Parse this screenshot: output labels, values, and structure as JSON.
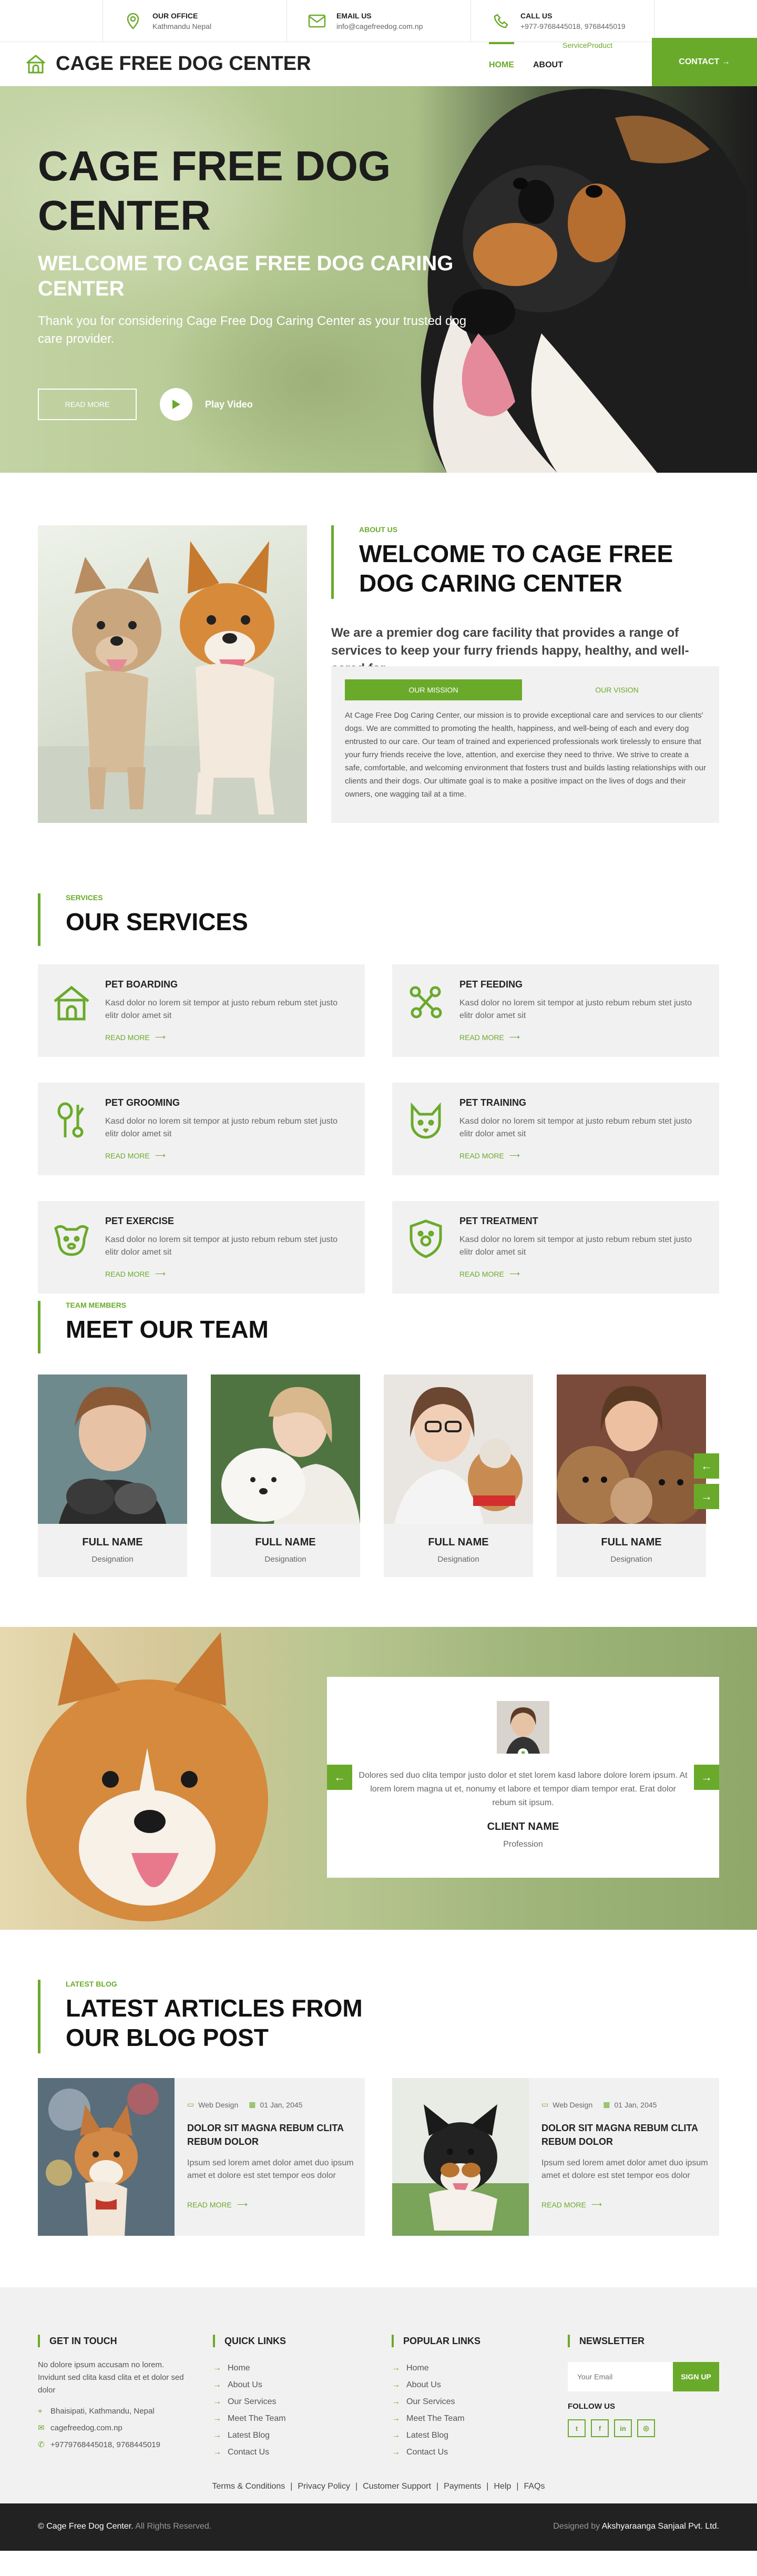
{
  "topbar": {
    "office": {
      "heading": "OUR OFFICE",
      "value": "Kathmandu Nepal",
      "icon": "location-pin-icon"
    },
    "email": {
      "heading": "EMAIL US",
      "value": "info@cagefreedog.com.np",
      "icon": "envelope-icon"
    },
    "call": {
      "heading": "CALL US",
      "value": "+977-9768445018, 9768445019",
      "icon": "phone-icon"
    }
  },
  "nav": {
    "brand": "CAGE FREE DOG CENTER",
    "items": [
      "HOME",
      "ABOUT"
    ],
    "dropdown": "ServiceProduct",
    "contact": "CONTACT →"
  },
  "hero": {
    "title": "CAGE FREE DOG CENTER",
    "subtitle": "WELCOME TO CAGE FREE DOG CARING CENTER",
    "text": "Thank you for considering Cage Free Dog Caring Center as your trusted dog care provider.",
    "read_more": "READ MORE",
    "play": "Play Video"
  },
  "about": {
    "tag": "ABOUT US",
    "heading": "WELCOME TO CAGE FREE DOG CARING CENTER",
    "lead": "We are a premier dog care facility that provides a range of services to keep your furry friends happy, healthy, and well-cared for.",
    "tab_mission": "OUR MISSION",
    "tab_vision": "OUR VISION",
    "text": "At Cage Free Dog Caring Center, our mission is to provide exceptional care and services to our clients' dogs. We are committed to promoting the health, happiness, and well-being of each and every dog entrusted to our care. Our team of trained and experienced professionals work tirelessly to ensure that your furry friends receive the love, attention, and exercise they need to thrive. We strive to create a safe, comfortable, and welcoming environment that fosters trust and builds lasting relationships with our clients and their dogs. Our ultimate goal is to make a positive impact on the lives of dogs and their owners, one wagging tail at a time."
  },
  "services": {
    "tag": "SERVICES",
    "heading": "OUR SERVICES",
    "read_more": "READ MORE",
    "items": [
      {
        "title": "PET BOARDING",
        "desc": "Kasd dolor no lorem sit tempor at justo rebum rebum stet justo elitr dolor amet sit",
        "icon": "dog-house-icon"
      },
      {
        "title": "PET FEEDING",
        "desc": "Kasd dolor no lorem sit tempor at justo rebum rebum stet justo elitr dolor amet sit",
        "icon": "bone-food-icon"
      },
      {
        "title": "PET GROOMING",
        "desc": "Kasd dolor no lorem sit tempor at justo rebum rebum stet justo elitr dolor amet sit",
        "icon": "scissors-comb-icon"
      },
      {
        "title": "PET TRAINING",
        "desc": "Kasd dolor no lorem sit tempor at justo rebum rebum stet justo elitr dolor amet sit",
        "icon": "cat-face-icon"
      },
      {
        "title": "PET EXERCISE",
        "desc": "Kasd dolor no lorem sit tempor at justo rebum rebum stet justo elitr dolor amet sit",
        "icon": "dog-face-icon"
      },
      {
        "title": "PET TREATMENT",
        "desc": "Kasd dolor no lorem sit tempor at justo rebum rebum stet justo elitr dolor amet sit",
        "icon": "shield-paw-icon"
      }
    ]
  },
  "team": {
    "tag": "TEAM MEMBERS",
    "heading": "MEET OUR TEAM",
    "members": [
      {
        "name": "FULL NAME",
        "role": "Designation"
      },
      {
        "name": "FULL NAME",
        "role": "Designation"
      },
      {
        "name": "FULL NAME",
        "role": "Designation"
      },
      {
        "name": "FULL NAME",
        "role": "Designation"
      }
    ]
  },
  "testimonial": {
    "quote": "Dolores sed duo clita tempor justo dolor et stet lorem kasd labore dolore lorem ipsum. At lorem lorem magna ut et, nonumy et labore et tempor diam tempor erat. Erat dolor rebum sit ipsum.",
    "name": "CLIENT NAME",
    "role": "Profession"
  },
  "blog": {
    "tag": "LATEST BLOG",
    "heading": "LATEST ARTICLES FROM OUR BLOG POST",
    "posts": [
      {
        "category": "Web Design",
        "date": "01 Jan, 2045",
        "title": "DOLOR SIT MAGNA REBUM CLITA REBUM DOLOR",
        "desc": "Ipsum sed lorem amet dolor amet duo ipsum amet et dolore est stet tempor eos dolor",
        "read_more": "READ MORE"
      },
      {
        "category": "Web Design",
        "date": "01 Jan, 2045",
        "title": "DOLOR SIT MAGNA REBUM CLITA REBUM DOLOR",
        "desc": "Ipsum sed lorem amet dolor amet duo ipsum amet et dolore est stet tempor eos dolor",
        "read_more": "READ MORE"
      }
    ]
  },
  "footer": {
    "touch": {
      "heading": "GET IN TOUCH",
      "text": "No dolore ipsum accusam no lorem. Invidunt sed clita kasd clita et et dolor sed dolor",
      "address": "Bhaisipati, Kathmandu, Nepal",
      "email": "cagefreedog.com.np",
      "phone": "+9779768445018, 9768445019"
    },
    "quick": {
      "heading": "QUICK LINKS",
      "links": [
        "Home",
        "About Us",
        "Our Services",
        "Meet The Team",
        "Latest Blog",
        "Contact Us"
      ]
    },
    "popular": {
      "heading": "POPULAR LINKS",
      "links": [
        "Home",
        "About Us",
        "Our Services",
        "Meet The Team",
        "Latest Blog",
        "Contact Us"
      ]
    },
    "newsletter": {
      "heading": "NEWSLETTER",
      "placeholder": "Your Email",
      "button": "SIGN UP",
      "follow": "FOLLOW US"
    },
    "bottom_links": [
      "Terms & Conditions",
      "Privacy Policy",
      "Customer Support",
      "Payments",
      "Help",
      "FAQs"
    ],
    "copyright_brand": "© Cage Free Dog Center.",
    "copyright_rest": " All Rights Reserved.",
    "designed_prefix": "Designed by ",
    "designed_by": "Akshyaraanga Sanjaal Pvt. Ltd."
  },
  "colors": {
    "accent": "#6aaa2b",
    "dark": "#222222",
    "panel": "#f1f1f1"
  }
}
